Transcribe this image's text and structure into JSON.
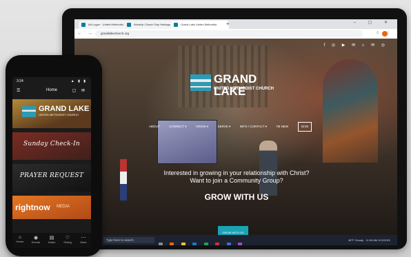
{
  "browser": {
    "tabs": [
      {
        "label": "Att Logon · United Methodist"
      },
      {
        "label": "Worship Church Day Heritage"
      },
      {
        "label": "Grand Lake United Methodist"
      }
    ],
    "add_tab": "+",
    "window_controls": "– ▢ ✕",
    "nav_buttons": "← → ⟳",
    "url": "grandlakechurch.org",
    "right_icons": "☆ ⋮"
  },
  "site": {
    "social_icons": "f ◎ ▶ ✉ ⌂ ✉ ◎",
    "logo": {
      "line1": "GRAND LAKE",
      "line2": "UNITED METHODIST CHURCH"
    },
    "nav": [
      "ABOUT",
      "CONNECT ▾",
      "GROW ▾",
      "SERVE ▾",
      "INFO / CONTACT ▾",
      "I'M NEW",
      "GIVE"
    ],
    "headline": "Interested in growing in your relationship with Christ?",
    "subheadline": "Want to join a Community Group?",
    "cta_title": "GROW WITH US",
    "cta_button": "GROW WITH US"
  },
  "taskbar": {
    "search_placeholder": "Type here to search",
    "weather": "46°F Cloudy",
    "time": "11:00 AM",
    "date": "1/12/2021"
  },
  "phone": {
    "status_time": "3:24",
    "status_icons": "▲ ▮ ▮",
    "title": "Home",
    "menu_icon": "☰",
    "top_icons": "▢ ✉",
    "cards": {
      "logo_line1": "GRAND LAKE",
      "logo_line2": "UNITED METHODIST CHURCH",
      "checkin": "Sunday Check-In",
      "prayer": "PRAYER REQUEST",
      "rightnow": "rightnow",
      "rightnow_sub": "MEDIA"
    },
    "bottom_nav": [
      {
        "icon": "⌂",
        "label": "Home"
      },
      {
        "icon": "◉",
        "label": "Events"
      },
      {
        "icon": "▤",
        "label": "Notes"
      },
      {
        "icon": "♡",
        "label": "Giving"
      },
      {
        "icon": "⋯",
        "label": "More"
      }
    ]
  }
}
